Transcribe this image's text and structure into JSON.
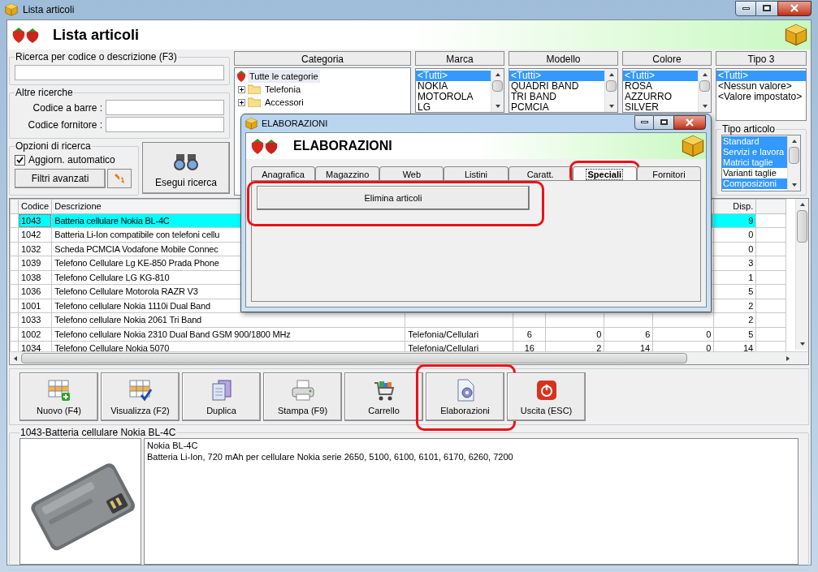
{
  "window": {
    "title": "Lista articoli"
  },
  "header": {
    "title": "Lista articoli"
  },
  "search": {
    "label": "Ricerca per codice o descrizione (F3)"
  },
  "other_searches": {
    "title": "Altre ricerche",
    "fields": [
      {
        "label": "Codice a barre :"
      },
      {
        "label": "Codice fornitore :"
      }
    ]
  },
  "search_options": {
    "title": "Opzioni di ricerca",
    "auto_update": {
      "label": "Aggiorn. automatico",
      "checked": true
    },
    "advanced_filters_button": "Filtri avanzati"
  },
  "run_search_button": "Esegui ricerca",
  "category": {
    "title": "Categoria",
    "items": [
      {
        "label": "Tutte le categorie",
        "selected": true,
        "children": [
          {
            "label": "Telefonia",
            "selected": false,
            "expanded": false
          },
          {
            "label": "Accessori",
            "selected": false,
            "expanded": false
          }
        ]
      }
    ]
  },
  "filters": [
    {
      "title": "Marca",
      "items": [
        {
          "label": "<Tutti>",
          "selected": true
        },
        {
          "label": "NOKIA",
          "selected": false
        },
        {
          "label": "MOTOROLA",
          "selected": false
        },
        {
          "label": "LG",
          "selected": false
        }
      ]
    },
    {
      "title": "Modello",
      "items": [
        {
          "label": "<Tutti>",
          "selected": true
        },
        {
          "label": "QUADRI BAND",
          "selected": false
        },
        {
          "label": "TRI BAND",
          "selected": false
        },
        {
          "label": "PCMCIA",
          "selected": false
        }
      ]
    },
    {
      "title": "Colore",
      "items": [
        {
          "label": "<Tutti>",
          "selected": true
        },
        {
          "label": "ROSA",
          "selected": false
        },
        {
          "label": "AZZURRO",
          "selected": false
        },
        {
          "label": "SILVER",
          "selected": false
        }
      ]
    },
    {
      "title": "Tipo 3",
      "items": [
        {
          "label": "<Tutti>",
          "selected": true
        },
        {
          "label": "<Nessun valore>",
          "selected": false
        },
        {
          "label": "<Valore impostato>",
          "selected": false
        }
      ]
    }
  ],
  "item_type": {
    "title": "Tipo articolo",
    "items": [
      {
        "label": "Standard",
        "selected": true
      },
      {
        "label": "Servizi e lavora",
        "selected": true
      },
      {
        "label": "Matrici taglie",
        "selected": true
      },
      {
        "label": "Varianti taglie",
        "selected": false
      },
      {
        "label": "Composizioni",
        "selected": true
      }
    ]
  },
  "table": {
    "columns": {
      "code": "Codice",
      "description": "Descrizione",
      "available": "Disp."
    },
    "rows": [
      {
        "selected": true,
        "code": "1043",
        "description": "Batteria cellulare Nokia BL-4C",
        "available": "9"
      },
      {
        "selected": false,
        "code": "1042",
        "description": "Batteria Li-Ion compatibile con telefoni cellu",
        "available": "0"
      },
      {
        "selected": false,
        "code": "1032",
        "description": "Scheda PCMCIA Vodafone Mobile Connec",
        "available": "0"
      },
      {
        "selected": false,
        "code": "1039",
        "description": "Telefono Cellulare Lg KE-850 Prada Phone",
        "available": "3"
      },
      {
        "selected": false,
        "code": "1038",
        "description": "Telefono Cellulare LG KG-810",
        "available": "1"
      },
      {
        "selected": false,
        "code": "1036",
        "description": "Telefono Cellulare Motorola RAZR V3",
        "available": "5"
      },
      {
        "selected": false,
        "code": "1001",
        "description": "Telefono cellulare Nokia 1110i Dual Band",
        "available": "2"
      },
      {
        "selected": false,
        "code": "1033",
        "description": "Telefono cellulare Nokia 2061 Tri Band",
        "available": "2"
      },
      {
        "selected": false,
        "code": "1002",
        "description": "Telefono cellulare Nokia 2310 Dual Band GSM 900/1800 MHz",
        "category": "Telefonia/Cellulari",
        "column_5": "6",
        "column_6": "0",
        "column_7": "6",
        "column_8": "0",
        "available": "5"
      },
      {
        "selected": false,
        "code": "1034",
        "description": "Telefono Cellulare Nokia 5070",
        "category": "Telefonia/Cellulari",
        "column_5": "16",
        "column_6": "2",
        "column_7": "14",
        "column_8": "0",
        "available": "14"
      }
    ]
  },
  "toolbar": [
    {
      "label": "Nuovo (F4)",
      "highlighted": false
    },
    {
      "label": "Visualizza (F2)",
      "highlighted": false
    },
    {
      "label": "Duplica",
      "highlighted": false
    },
    {
      "label": "Stampa (F9)",
      "highlighted": false
    },
    {
      "label": "Carrello",
      "highlighted": false
    },
    {
      "label": "Elaborazioni",
      "highlighted": true
    },
    {
      "label": "Uscita (ESC)",
      "highlighted": false
    }
  ],
  "detail": {
    "title": "1043-Batteria cellulare Nokia BL-4C",
    "lines": [
      "Nokia BL-4C",
      "Batteria Li-Ion, 720 mAh per cellulare Nokia serie 2650, 5100, 6100, 6101, 6170, 6260, 7200"
    ]
  },
  "dialog": {
    "title": "ELABORAZIONI",
    "header": "ELABORAZIONI",
    "tabs": [
      {
        "label": "Anagrafica",
        "selected": false,
        "highlighted": false
      },
      {
        "label": "Magazzino",
        "selected": false,
        "highlighted": false
      },
      {
        "label": "Web",
        "selected": false,
        "highlighted": false
      },
      {
        "label": "Listini",
        "selected": false,
        "highlighted": false
      },
      {
        "label": "Caratt.",
        "selected": false,
        "highlighted": false
      },
      {
        "label": "Speciali",
        "selected": true,
        "highlighted": true
      },
      {
        "label": "Fornitori",
        "selected": false,
        "highlighted": false
      }
    ],
    "actions": [
      {
        "label": "Elimina articoli",
        "highlighted": true
      }
    ]
  }
}
